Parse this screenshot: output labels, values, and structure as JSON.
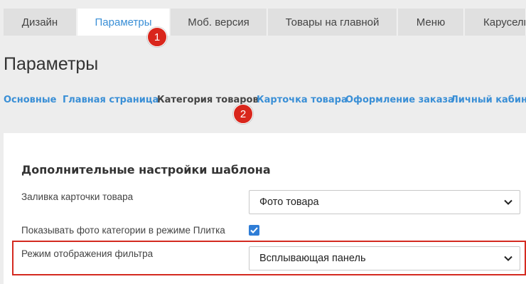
{
  "tabs": [
    {
      "label": "Дизайн"
    },
    {
      "label": "Параметры",
      "active": true
    },
    {
      "label": "Моб. версия"
    },
    {
      "label": "Товары на главной"
    },
    {
      "label": "Меню"
    },
    {
      "label": "Карусель"
    }
  ],
  "badges": {
    "first": "1",
    "second": "2"
  },
  "page": {
    "title": "Параметры"
  },
  "subnav": [
    {
      "label": "Основные"
    },
    {
      "label": "Главная страница"
    },
    {
      "label": "Категория товаров",
      "current": true
    },
    {
      "label": "Карточка товара"
    },
    {
      "label": "Оформление заказа"
    },
    {
      "label": "Личный кабинет"
    }
  ],
  "section": {
    "title": "Дополнительные настройки шаблона",
    "fill_label": "Заливка карточки товара",
    "fill_value": "Фото товара",
    "photo_label": "Показывать фото категории в режиме Плитка",
    "photo_checked": true,
    "filter_label": "Режим отображения фильтра",
    "filter_value": "Всплывающая панель"
  },
  "colors": {
    "accent": "#3a8fd6",
    "badge": "#d9261c",
    "highlight": "#d42a20",
    "checkbox": "#2f7dd6"
  },
  "icons": {
    "select_arrow": "chevron-down-icon",
    "checkbox_mark": "checkmark-icon"
  }
}
